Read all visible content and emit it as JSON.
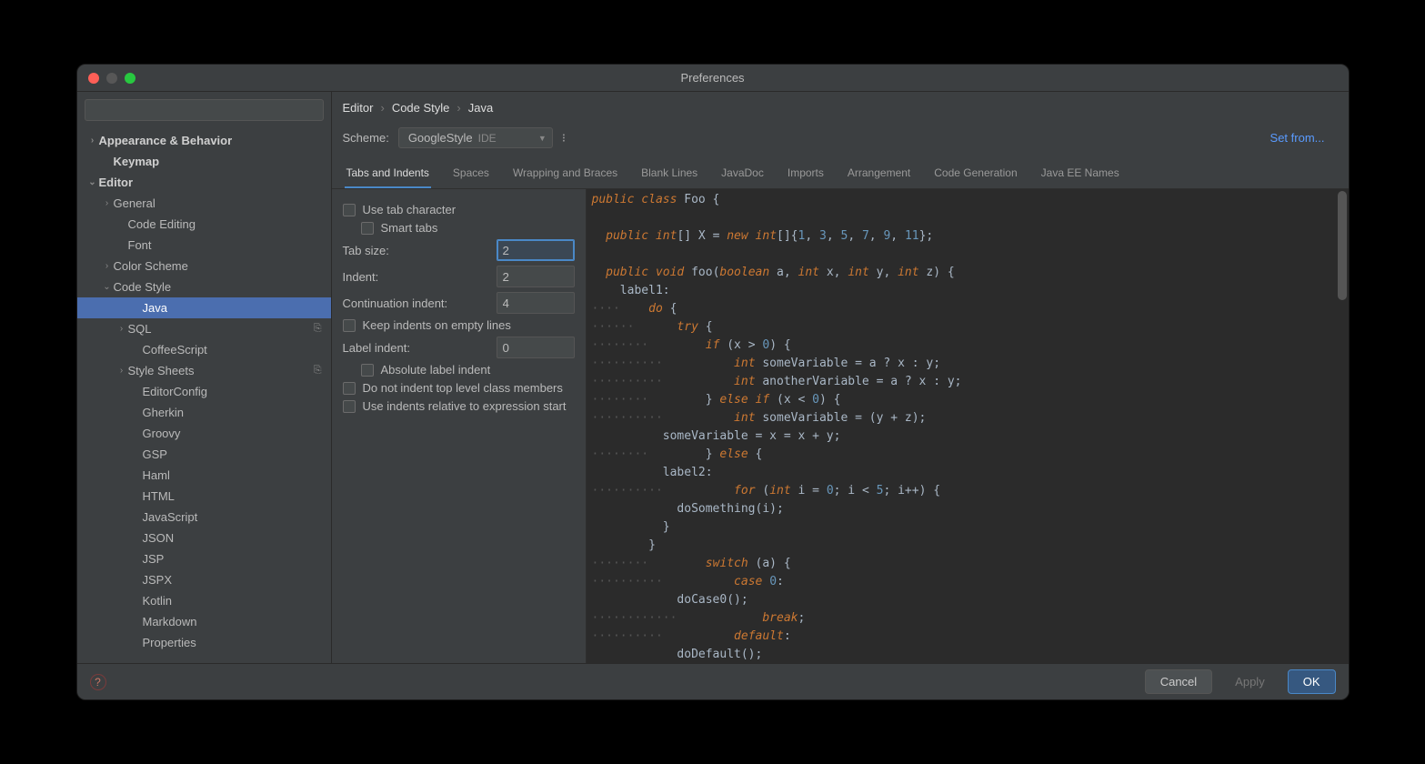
{
  "title": "Preferences",
  "sidebar": {
    "search_placeholder": "",
    "items": [
      {
        "label": "Appearance & Behavior",
        "bold": true,
        "chev": "›",
        "lvl": 0
      },
      {
        "label": "Keymap",
        "bold": true,
        "lvl": 1,
        "nochev": true
      },
      {
        "label": "Editor",
        "bold": true,
        "chev": "⌄",
        "lvl": 0
      },
      {
        "label": "General",
        "chev": "›",
        "lvl": 1
      },
      {
        "label": "Code Editing",
        "lvl": 2,
        "nochev": true
      },
      {
        "label": "Font",
        "lvl": 2,
        "nochev": true
      },
      {
        "label": "Color Scheme",
        "chev": "›",
        "lvl": 1
      },
      {
        "label": "Code Style",
        "chev": "⌄",
        "lvl": 1
      },
      {
        "label": "Java",
        "lvl": 3,
        "selected": true,
        "nochev": true
      },
      {
        "label": "SQL",
        "chev": "›",
        "lvl": 2,
        "meta": "⎘"
      },
      {
        "label": "CoffeeScript",
        "lvl": 3,
        "nochev": true
      },
      {
        "label": "Style Sheets",
        "chev": "›",
        "lvl": 2,
        "meta": "⎘"
      },
      {
        "label": "EditorConfig",
        "lvl": 3,
        "nochev": true
      },
      {
        "label": "Gherkin",
        "lvl": 3,
        "nochev": true
      },
      {
        "label": "Groovy",
        "lvl": 3,
        "nochev": true
      },
      {
        "label": "GSP",
        "lvl": 3,
        "nochev": true
      },
      {
        "label": "Haml",
        "lvl": 3,
        "nochev": true
      },
      {
        "label": "HTML",
        "lvl": 3,
        "nochev": true
      },
      {
        "label": "JavaScript",
        "lvl": 3,
        "nochev": true
      },
      {
        "label": "JSON",
        "lvl": 3,
        "nochev": true
      },
      {
        "label": "JSP",
        "lvl": 3,
        "nochev": true
      },
      {
        "label": "JSPX",
        "lvl": 3,
        "nochev": true
      },
      {
        "label": "Kotlin",
        "lvl": 3,
        "nochev": true
      },
      {
        "label": "Markdown",
        "lvl": 3,
        "nochev": true
      },
      {
        "label": "Properties",
        "lvl": 3,
        "nochev": true
      }
    ]
  },
  "breadcrumb": {
    "p0": "Editor",
    "p1": "Code Style",
    "p2": "Java"
  },
  "scheme": {
    "label": "Scheme:",
    "name": "GoogleStyle",
    "scope": "IDE"
  },
  "setfrom": "Set from...",
  "tabs": [
    "Tabs and Indents",
    "Spaces",
    "Wrapping and Braces",
    "Blank Lines",
    "JavaDoc",
    "Imports",
    "Arrangement",
    "Code Generation",
    "Java EE Names"
  ],
  "form": {
    "use_tab": "Use tab character",
    "smart_tabs": "Smart tabs",
    "tab_size_label": "Tab size:",
    "tab_size": "2",
    "indent_label": "Indent:",
    "indent": "2",
    "cont_label": "Continuation indent:",
    "cont": "4",
    "keep_empty": "Keep indents on empty lines",
    "label_indent_label": "Label indent:",
    "label_indent": "0",
    "abs_label": "Absolute label indent",
    "no_top": "Do not indent top level class members",
    "rel_expr": "Use indents relative to expression start"
  },
  "footer": {
    "cancel": "Cancel",
    "apply": "Apply",
    "ok": "OK"
  },
  "code": {
    "l1a": "public class ",
    "l1b": "Foo {",
    "l2a": "  public ",
    "l2ty": "int",
    "l2b": "[] X = ",
    "l2new": "new ",
    "l2c": "int",
    "l2d": "[]{",
    "l2n1": "1",
    "l2n2": "3",
    "l2n3": "5",
    "l2n4": "7",
    "l2n5": "9",
    "l2n6": "11",
    "l2e": "};",
    "l3a": "  public ",
    "l3ty": "void ",
    "l3b": "foo(",
    "l3bt": "boolean ",
    "l3c": "a, ",
    "l3i1": "int ",
    "l3d": "x, ",
    "l3i2": "int ",
    "l3e": "y, ",
    "l3i3": "int ",
    "l3f": "z) {",
    "l4": "    label1:",
    "l5a": "    do ",
    "l5b": "{",
    "l6a": "      try ",
    "l6b": "{",
    "l7a": "        if ",
    "l7b": "(x > ",
    "l7n": "0",
    "l7c": ") {",
    "l8a": "          int ",
    "l8b": "someVariable = a ? x : y;",
    "l9a": "          int ",
    "l9b": "anotherVariable = a ? x : y;",
    "l10a": "        } ",
    "l10b": "else if ",
    "l10c": "(x < ",
    "l10n": "0",
    "l10d": ") {",
    "l11a": "          int ",
    "l11b": "someVariable = (y + z);",
    "l12": "          someVariable = x = x + y;",
    "l13a": "        } ",
    "l13b": "else ",
    "l13c": "{",
    "l14": "          label2:",
    "l15a": "          for ",
    "l15b": "(",
    "l15ty": "int ",
    "l15c": "i = ",
    "l15n1": "0",
    "l15d": "; i < ",
    "l15n2": "5",
    "l15e": "; i++) {",
    "l16": "            doSomething(i);",
    "l17": "          }",
    "l18": "        }",
    "l19a": "        switch ",
    "l19b": "(a) {",
    "l20a": "          case ",
    "l20n": "0",
    "l20b": ":",
    "l21": "            doCase0();",
    "l22a": "            break",
    "l22b": ";",
    "l23a": "          default",
    "l23b": ":",
    "l24": "            doDefault();"
  }
}
